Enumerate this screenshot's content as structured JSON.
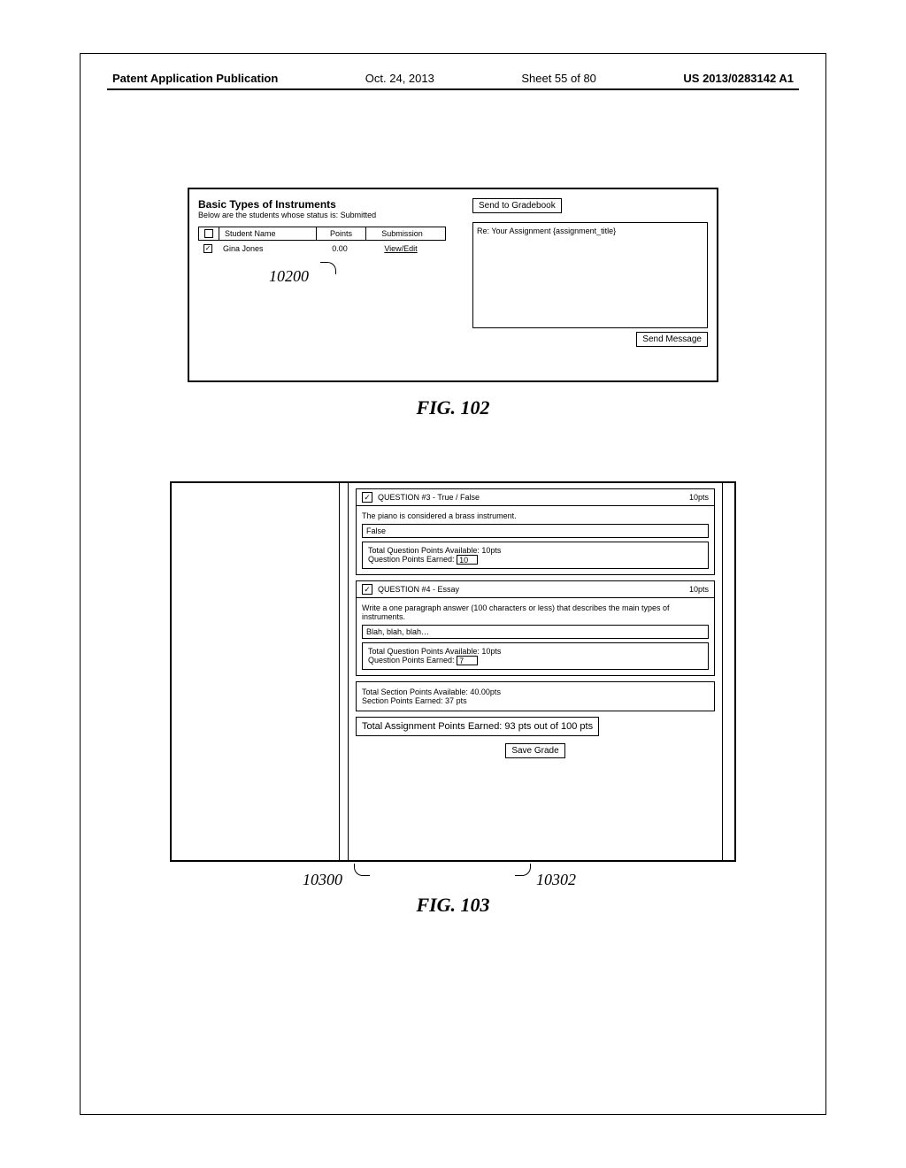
{
  "header": {
    "left": "Patent Application Publication",
    "date": "Oct. 24, 2013",
    "sheet": "Sheet 55 of 80",
    "pubnum": "US 2013/0283142 A1"
  },
  "fig102": {
    "title": "Basic Types of Instruments",
    "subtitle": "Below are the students whose status is: Submitted",
    "columns": {
      "name": "Student Name",
      "points": "Points",
      "submission": "Submission"
    },
    "row": {
      "checked": "✓",
      "name": "Gina Jones",
      "points": "0.00",
      "action": "View/Edit"
    },
    "ref": "10200",
    "send_gradebook": "Send to Gradebook",
    "msg_subject": "Re: Your Assignment {assignment_title}",
    "send_message": "Send Message",
    "label": "FIG. 102"
  },
  "fig103": {
    "q3": {
      "header": "QUESTION #3 - True / False",
      "pts": "10pts",
      "prompt": "The piano is considered a brass instrument.",
      "answer": "False",
      "avail": "Total Question Points Available: 10pts",
      "earned_label": "Question Points Earned:",
      "earned_value": "10"
    },
    "q4": {
      "header": "QUESTION #4 - Essay",
      "pts": "10pts",
      "prompt": "Write a one paragraph answer (100 characters or less) that describes the main types of instruments.",
      "answer": "Blah, blah, blah…",
      "avail": "Total Question Points Available: 10pts",
      "earned_label": "Question Points Earned:",
      "earned_value": "7"
    },
    "section": {
      "avail": "Total Section Points Available: 40.00pts",
      "earned": "Section Points Earned: 37 pts"
    },
    "total": "Total Assignment Points Earned: 93 pts out of 100 pts",
    "save": "Save Grade",
    "ref_left": "10300",
    "ref_right": "10302",
    "label": "FIG. 103"
  }
}
